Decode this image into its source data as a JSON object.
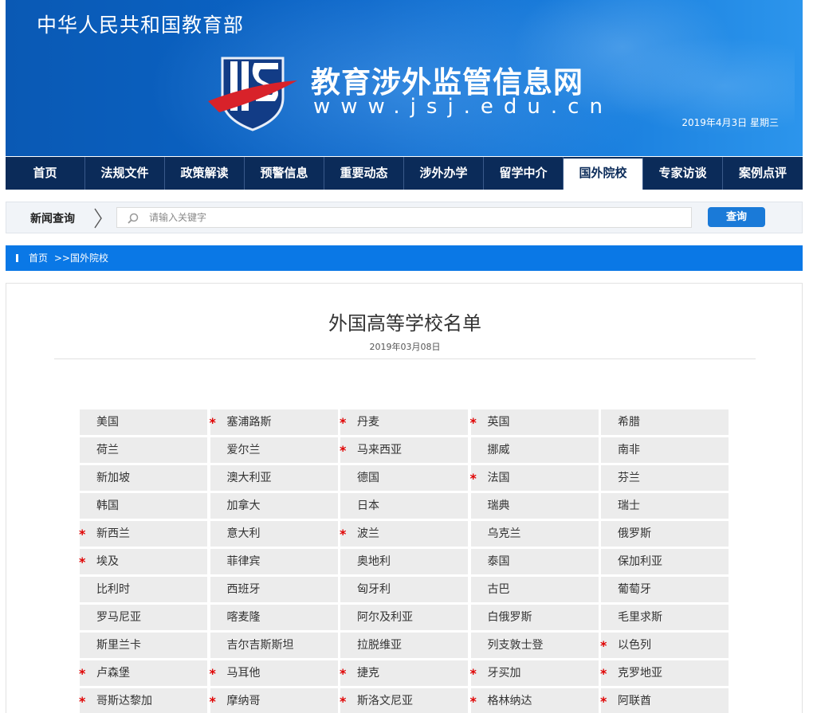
{
  "header": {
    "ministry": "中华人民共和国教育部",
    "site_name": "教育涉外监管信息网",
    "site_url": "www.jsj.edu.cn",
    "date": "2019年4月3日  星期三"
  },
  "nav": {
    "items": [
      {
        "label": "首页"
      },
      {
        "label": "法规文件"
      },
      {
        "label": "政策解读"
      },
      {
        "label": "预警信息"
      },
      {
        "label": "重要动态"
      },
      {
        "label": "涉外办学"
      },
      {
        "label": "留学中介"
      },
      {
        "label": "国外院校"
      },
      {
        "label": "专家访谈"
      },
      {
        "label": "案例点评"
      }
    ],
    "active": "国外院校"
  },
  "search": {
    "label": "新闻查询",
    "placeholder": "请输入关键字",
    "button": "查询"
  },
  "breadcrumb": {
    "home": "首页",
    "separator": ">>",
    "current": "国外院校"
  },
  "article": {
    "title": "外国高等学校名单",
    "date": "2019年03月08日"
  },
  "countries": [
    {
      "name": "美国",
      "star": false
    },
    {
      "name": "塞浦路斯",
      "star": true
    },
    {
      "name": "丹麦",
      "star": true
    },
    {
      "name": "英国",
      "star": true
    },
    {
      "name": "希腊",
      "star": false
    },
    {
      "name": "荷兰",
      "star": false
    },
    {
      "name": "爱尔兰",
      "star": false
    },
    {
      "name": "马来西亚",
      "star": true
    },
    {
      "name": "挪威",
      "star": false
    },
    {
      "name": "南非",
      "star": false
    },
    {
      "name": "新加坡",
      "star": false
    },
    {
      "name": "澳大利亚",
      "star": false
    },
    {
      "name": "德国",
      "star": false
    },
    {
      "name": "法国",
      "star": true
    },
    {
      "name": "芬兰",
      "star": false
    },
    {
      "name": "韩国",
      "star": false
    },
    {
      "name": "加拿大",
      "star": false
    },
    {
      "name": "日本",
      "star": false
    },
    {
      "name": "瑞典",
      "star": false
    },
    {
      "name": "瑞士",
      "star": false
    },
    {
      "name": "新西兰",
      "star": true
    },
    {
      "name": "意大利",
      "star": false
    },
    {
      "name": "波兰",
      "star": true
    },
    {
      "name": "乌克兰",
      "star": false
    },
    {
      "name": "俄罗斯",
      "star": false
    },
    {
      "name": "埃及",
      "star": true
    },
    {
      "name": "菲律宾",
      "star": false
    },
    {
      "name": "奥地利",
      "star": false
    },
    {
      "name": "泰国",
      "star": false
    },
    {
      "name": "保加利亚",
      "star": false
    },
    {
      "name": "比利时",
      "star": false
    },
    {
      "name": "西班牙",
      "star": false
    },
    {
      "name": "匈牙利",
      "star": false
    },
    {
      "name": "古巴",
      "star": false
    },
    {
      "name": "葡萄牙",
      "star": false
    },
    {
      "name": "罗马尼亚",
      "star": false
    },
    {
      "name": "喀麦隆",
      "star": false
    },
    {
      "name": "阿尔及利亚",
      "star": false
    },
    {
      "name": "白俄罗斯",
      "star": false
    },
    {
      "name": "毛里求斯",
      "star": false
    },
    {
      "name": "斯里兰卡",
      "star": false
    },
    {
      "name": "吉尔吉斯斯坦",
      "star": false
    },
    {
      "name": "拉脱维亚",
      "star": false
    },
    {
      "name": "列支敦士登",
      "star": false
    },
    {
      "name": "以色列",
      "star": true
    },
    {
      "name": "卢森堡",
      "star": true
    },
    {
      "name": "马耳他",
      "star": true
    },
    {
      "name": "捷克",
      "star": true
    },
    {
      "name": "牙买加",
      "star": true
    },
    {
      "name": "克罗地亚",
      "star": true
    },
    {
      "name": "哥斯达黎加",
      "star": true
    },
    {
      "name": "摩纳哥",
      "star": true
    },
    {
      "name": "斯洛文尼亚",
      "star": true
    },
    {
      "name": "格林纳达",
      "star": true
    },
    {
      "name": "阿联酋",
      "star": true
    }
  ],
  "star_mark": "*",
  "colors": {
    "banner_blue": "#0b66c9",
    "nav_navy": "#0b2b59",
    "breadcrumb_blue": "#0a78e6",
    "button_blue": "#1a7ad8",
    "star_red": "#e00000",
    "cell_gray": "#ececec"
  }
}
